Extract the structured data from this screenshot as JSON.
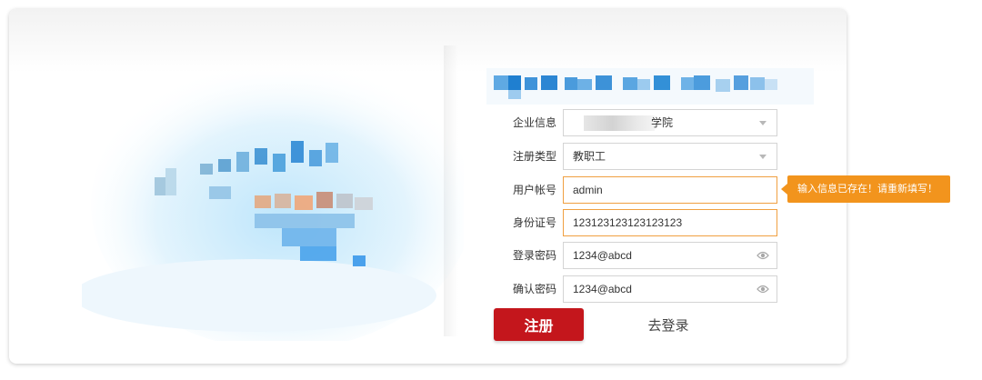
{
  "form": {
    "enterprise": {
      "label": "企业信息",
      "value_suffix": "学院"
    },
    "register_type": {
      "label": "注册类型",
      "value": "教职工"
    },
    "username": {
      "label": "用户帐号",
      "value": "admin"
    },
    "id_number": {
      "label": "身份证号",
      "value": "123123123123123123"
    },
    "password": {
      "label": "登录密码",
      "value": "1234@abcd"
    },
    "confirm_password": {
      "label": "确认密码",
      "value": "1234@abcd"
    }
  },
  "tooltip": {
    "text": "输入信息已存在！请重新填写！"
  },
  "actions": {
    "register_label": "注册",
    "login_label": "去登录"
  },
  "colors": {
    "primary_button": "#c4161c",
    "error_border": "#f0a041",
    "tooltip_bg": "#f2941d"
  }
}
